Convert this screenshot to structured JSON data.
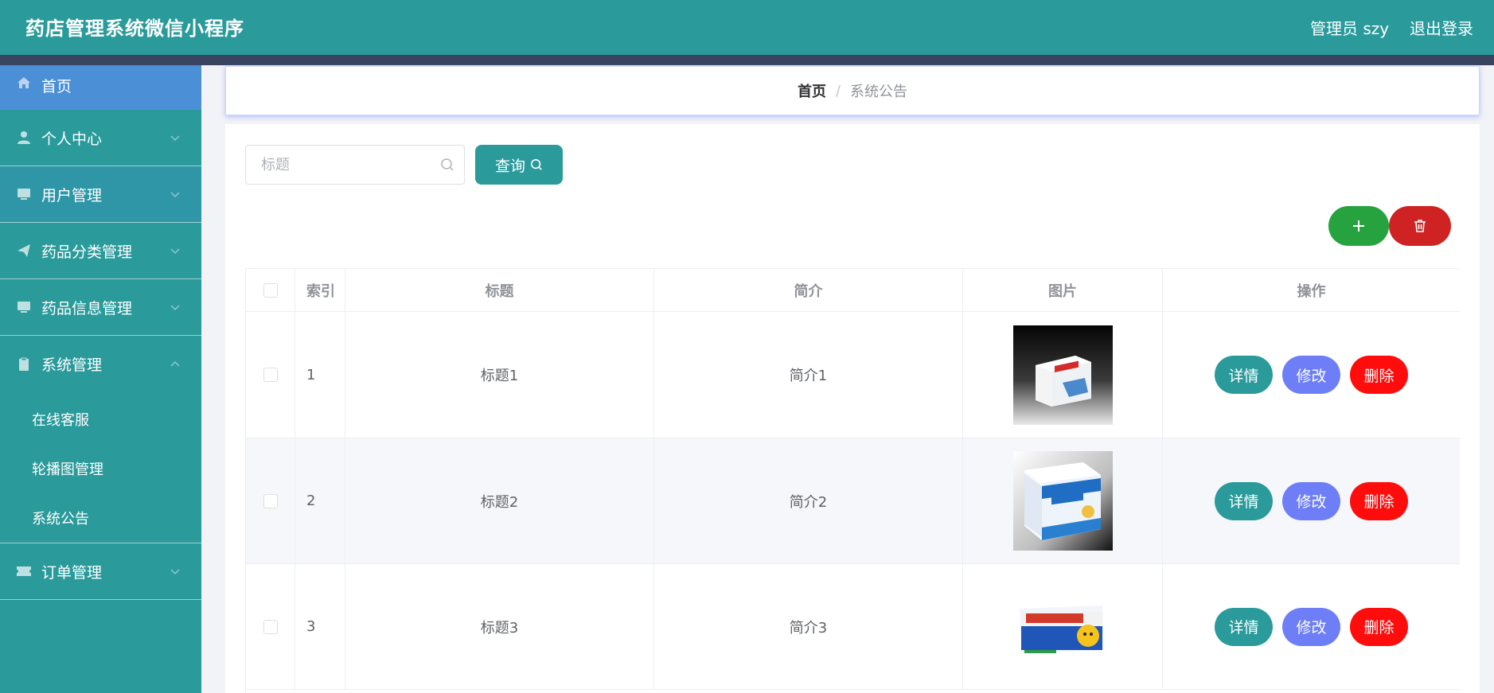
{
  "header": {
    "title": "药店管理系统微信小程序",
    "user_label": "管理员 szy",
    "logout_label": "退出登录"
  },
  "sidebar": {
    "items": [
      {
        "label": "首页",
        "icon": "home-icon"
      },
      {
        "label": "个人中心",
        "icon": "user-icon"
      },
      {
        "label": "用户管理",
        "icon": "monitor-icon"
      },
      {
        "label": "药品分类管理",
        "icon": "send-icon"
      },
      {
        "label": "药品信息管理",
        "icon": "monitor-icon"
      },
      {
        "label": "系统管理",
        "icon": "clipboard-icon",
        "expanded": true
      },
      {
        "label": "订单管理",
        "icon": "ticket-icon"
      }
    ],
    "sub_items": [
      {
        "label": "在线客服"
      },
      {
        "label": "轮播图管理"
      },
      {
        "label": "系统公告"
      }
    ]
  },
  "breadcrumb": {
    "home": "首页",
    "separator": "/",
    "current": "系统公告"
  },
  "search": {
    "placeholder": "标题",
    "value": "",
    "button_label": "查询"
  },
  "table": {
    "headers": {
      "index": "索引",
      "title": "标题",
      "intro": "简介",
      "image": "图片",
      "actions": "操作"
    },
    "rows": [
      {
        "index": "1",
        "title": "标题1",
        "intro": "简介1"
      },
      {
        "index": "2",
        "title": "标题2",
        "intro": "简介2"
      },
      {
        "index": "3",
        "title": "标题3",
        "intro": "简介3"
      }
    ],
    "action_labels": {
      "detail": "详情",
      "edit": "修改",
      "delete": "删除"
    }
  },
  "colors": {
    "primary": "#2a9a9b",
    "sidebar_active": "#4b90d6",
    "add": "#26a33f",
    "batch_delete": "#cf2323",
    "edit": "#6d7ef7",
    "delete": "#ff0d0d"
  }
}
